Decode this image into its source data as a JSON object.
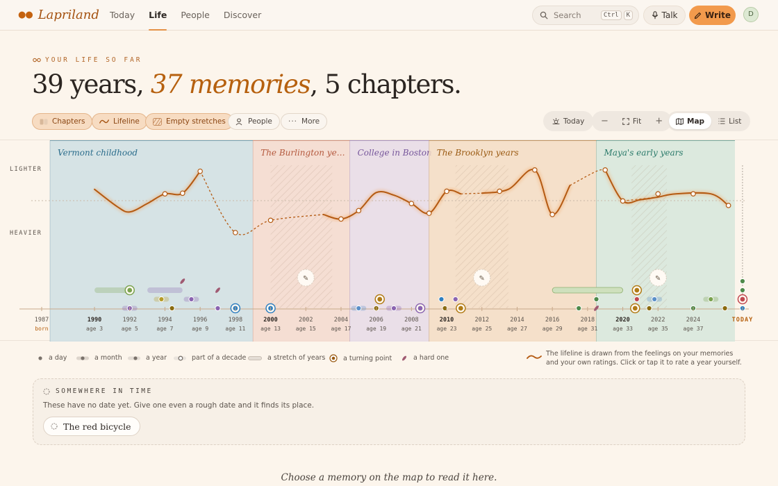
{
  "app": {
    "name": "Lapriland",
    "avatar_initial": "D"
  },
  "nav": [
    {
      "label": "Today",
      "active": false
    },
    {
      "label": "Life",
      "active": true
    },
    {
      "label": "People",
      "active": false
    },
    {
      "label": "Discover",
      "active": false
    }
  ],
  "search": {
    "placeholder": "Search",
    "shortcut_mod": "Ctrl",
    "shortcut_key": "K"
  },
  "actions": {
    "talk": "Talk",
    "write": "Write"
  },
  "hero": {
    "kicker": "YOUR LIFE SO FAR",
    "headline_years": "39 years,",
    "headline_memories": "37 memories",
    "headline_chapters": ", 5 chapters."
  },
  "chips": [
    {
      "label": "Chapters",
      "on": true
    },
    {
      "label": "Lifeline",
      "on": true
    },
    {
      "label": "Empty stretches",
      "on": true
    },
    {
      "label": "People",
      "on": false
    },
    {
      "label": "More",
      "on": false
    }
  ],
  "view": {
    "today": "Today",
    "fit": "Fit",
    "map": "Map",
    "list": "List"
  },
  "chart_data": {
    "type": "line",
    "title": "",
    "xlabel": "",
    "ylabel": "",
    "y_labels": {
      "top": "LIGHTER",
      "bottom": "HEAVIER"
    },
    "x_range": [
      1987,
      2026
    ],
    "chapters": [
      {
        "name": "Vermont childhood",
        "start": 1987,
        "end": 1999,
        "color": "#cfdfe4",
        "text": "#2b6d8c"
      },
      {
        "name": "The Burlington ye…",
        "start": 1999,
        "end": 2004.5,
        "color": "#f3d9cf",
        "text": "#b4593e"
      },
      {
        "name": "College in Boston",
        "start": 2004.5,
        "end": 2009,
        "color": "#e6dbe8",
        "text": "#76569b"
      },
      {
        "name": "The Brooklyn years",
        "start": 2009,
        "end": 2018.5,
        "color": "#f3dcc4",
        "text": "#9a5a12"
      },
      {
        "name": "Maya's early years",
        "start": 2018.5,
        "end": 2026.5,
        "color": "#d6e6dc",
        "text": "#2a7a6a"
      }
    ],
    "empty_stretches": [
      [
        2000,
        2003.5
      ],
      [
        2010.5,
        2013.5
      ],
      [
        2020.5,
        2022.5
      ]
    ],
    "lifeline_solid": [
      [
        [
          1990,
          0.33
        ],
        [
          1991.3,
          0.6
        ],
        [
          1992,
          0.68
        ],
        [
          1993,
          0.55
        ],
        [
          1994,
          0.4
        ],
        [
          1995,
          0.39
        ],
        [
          1996,
          0.05
        ]
      ],
      [
        [
          2003,
          0.72
        ],
        [
          2004,
          0.79
        ],
        [
          2005,
          0.66
        ],
        [
          2006,
          0.38
        ],
        [
          2007,
          0.42
        ],
        [
          2008,
          0.55
        ],
        [
          2009,
          0.7
        ],
        [
          2010,
          0.36
        ],
        [
          2010.8,
          0.4
        ]
      ],
      [
        [
          2012,
          0.39
        ],
        [
          2013.5,
          0.33
        ],
        [
          2015,
          0.03
        ],
        [
          2016,
          0.72
        ],
        [
          2017,
          0.27
        ]
      ],
      [
        [
          2019,
          0.03
        ],
        [
          2020,
          0.51
        ],
        [
          2021,
          0.49
        ],
        [
          2022,
          0.45
        ],
        [
          2023,
          0.4
        ],
        [
          2025,
          0.4
        ],
        [
          2026,
          0.58
        ]
      ]
    ],
    "lifeline_dashed": [
      [
        [
          1996,
          0.05
        ],
        [
          1998,
          1.0
        ],
        [
          2000,
          0.81
        ],
        [
          2003,
          0.72
        ]
      ],
      [
        [
          2010.8,
          0.4
        ],
        [
          2012,
          0.39
        ]
      ],
      [
        [
          2017,
          0.27
        ],
        [
          2018.5,
          0.05
        ],
        [
          2019,
          0.03
        ]
      ],
      [
        [
          2020,
          0.51
        ],
        [
          2022,
          0.45
        ]
      ]
    ],
    "rated_points": [
      [
        1994,
        0.4
      ],
      [
        1995,
        0.39
      ],
      [
        1996,
        0.05
      ],
      [
        1998,
        1.0
      ],
      [
        2000,
        0.81
      ],
      [
        2004,
        0.79
      ],
      [
        2005,
        0.66
      ],
      [
        2008,
        0.55
      ],
      [
        2009,
        0.7
      ],
      [
        2010,
        0.36
      ],
      [
        2013,
        0.36
      ],
      [
        2015,
        0.03
      ],
      [
        2016,
        0.72
      ],
      [
        2019,
        0.03
      ],
      [
        2020,
        0.51
      ],
      [
        2022,
        0.4
      ],
      [
        2024,
        0.4
      ],
      [
        2026,
        0.58
      ]
    ],
    "memories": [
      {
        "kind": "decade",
        "start": 1990,
        "end": 1992,
        "row": 2,
        "color": "#7aa24f"
      },
      {
        "kind": "turning",
        "x": 1992,
        "row": 2,
        "color": "#7aa24f"
      },
      {
        "kind": "hard",
        "x": 1995,
        "row": 1,
        "color": "#a05a72"
      },
      {
        "kind": "decade",
        "start": 1993,
        "end": 1995,
        "row": 2,
        "color": "#8a64b0"
      },
      {
        "kind": "hard",
        "x": 1997,
        "row": 2,
        "color": "#a05a72"
      },
      {
        "kind": "year",
        "x": 1993.8,
        "row": 3,
        "color": "#b59b28"
      },
      {
        "kind": "year",
        "x": 1995.5,
        "row": 3,
        "color": "#8a64b0"
      },
      {
        "kind": "month",
        "x": 1992,
        "row": 4,
        "color": "#8a64b0"
      },
      {
        "kind": "day",
        "x": 1994.4,
        "row": 4,
        "color": "#8a6b10"
      },
      {
        "kind": "day",
        "x": 1997,
        "row": 4,
        "color": "#8a64b0"
      },
      {
        "kind": "turning",
        "x": 1998,
        "row": 4,
        "color": "#2f7fc0"
      },
      {
        "kind": "turning",
        "x": 2000,
        "row": 4,
        "color": "#2f7fc0"
      },
      {
        "kind": "turning",
        "x": 2006.2,
        "row": 3,
        "color": "#b07a14"
      },
      {
        "kind": "month",
        "x": 2005,
        "row": 4,
        "color": "#5a8fc8"
      },
      {
        "kind": "day",
        "x": 2006,
        "row": 4,
        "color": "#8a6b10"
      },
      {
        "kind": "month",
        "x": 2007,
        "row": 4,
        "color": "#8a64b0"
      },
      {
        "kind": "turning",
        "x": 2008.5,
        "row": 4,
        "color": "#8a64b0"
      },
      {
        "kind": "day",
        "x": 2009.7,
        "row": 3,
        "color": "#2f7fc0"
      },
      {
        "kind": "day",
        "x": 2009.9,
        "row": 4,
        "color": "#8a6b10"
      },
      {
        "kind": "day",
        "x": 2010.5,
        "row": 3,
        "color": "#8a64b0"
      },
      {
        "kind": "turning",
        "x": 2010.8,
        "row": 4,
        "color": "#b07a14"
      },
      {
        "kind": "stretch",
        "start": 2016,
        "end": 2020,
        "row": 2,
        "color": "#7aa24f"
      },
      {
        "kind": "day",
        "x": 2018.5,
        "row": 3,
        "color": "#4f8a4a"
      },
      {
        "kind": "day",
        "x": 2017.5,
        "row": 4,
        "color": "#4f8a4a"
      },
      {
        "kind": "hard",
        "x": 2018.5,
        "row": 4,
        "color": "#a05a72"
      },
      {
        "kind": "turning",
        "x": 2020.8,
        "row": 2,
        "color": "#b07a14"
      },
      {
        "kind": "day",
        "x": 2020.8,
        "row": 3,
        "color": "#c0474f"
      },
      {
        "kind": "turning",
        "x": 2020.7,
        "row": 4,
        "color": "#b07a14"
      },
      {
        "kind": "month",
        "x": 2021.8,
        "row": 3,
        "color": "#5a8fc8"
      },
      {
        "kind": "day",
        "x": 2021.5,
        "row": 4,
        "color": "#8a6b10"
      },
      {
        "kind": "month",
        "x": 2025,
        "row": 3,
        "color": "#7aa24f"
      },
      {
        "kind": "day",
        "x": 2024,
        "row": 4,
        "color": "#4f8a4a"
      },
      {
        "kind": "day",
        "x": 2025.8,
        "row": 4,
        "color": "#8a6b10"
      },
      {
        "kind": "day",
        "x": 2026.8,
        "row": 1,
        "color": "#4f8a4a"
      },
      {
        "kind": "day",
        "x": 2026.8,
        "row": 2,
        "color": "#4f8a4a"
      },
      {
        "kind": "turning",
        "x": 2026.8,
        "row": 3,
        "color": "#c0474f"
      },
      {
        "kind": "day",
        "x": 2026.8,
        "row": 4,
        "color": "#2f7fc0"
      }
    ],
    "write_markers": [
      2002,
      2012,
      2022
    ],
    "x_ticks": [
      {
        "year": "1987",
        "age": "born",
        "x": 1987,
        "bold": false
      },
      {
        "year": "1990",
        "age": "age 3",
        "x": 1990,
        "bold": true
      },
      {
        "year": "1992",
        "age": "age 5",
        "x": 1992,
        "bold": false
      },
      {
        "year": "1994",
        "age": "age 7",
        "x": 1994,
        "bold": false
      },
      {
        "year": "1996",
        "age": "age 9",
        "x": 1996,
        "bold": false
      },
      {
        "year": "1998",
        "age": "age 11",
        "x": 1998,
        "bold": false
      },
      {
        "year": "2000",
        "age": "age 13",
        "x": 2000,
        "bold": true
      },
      {
        "year": "2002",
        "age": "age 15",
        "x": 2002,
        "bold": false
      },
      {
        "year": "2004",
        "age": "age 17",
        "x": 2004,
        "bold": false
      },
      {
        "year": "2006",
        "age": "age 19",
        "x": 2006,
        "bold": false
      },
      {
        "year": "2008",
        "age": "age 21",
        "x": 2008,
        "bold": false
      },
      {
        "year": "2010",
        "age": "age 23",
        "x": 2010,
        "bold": true
      },
      {
        "year": "2012",
        "age": "age 25",
        "x": 2012,
        "bold": false
      },
      {
        "year": "2014",
        "age": "age 27",
        "x": 2014,
        "bold": false
      },
      {
        "year": "2016",
        "age": "age 29",
        "x": 2016,
        "bold": false
      },
      {
        "year": "2018",
        "age": "age 31",
        "x": 2018,
        "bold": false
      },
      {
        "year": "2020",
        "age": "age 33",
        "x": 2020,
        "bold": true
      },
      {
        "year": "2022",
        "age": "age 35",
        "x": 2022,
        "bold": false
      },
      {
        "year": "2024",
        "age": "age 37",
        "x": 2024,
        "bold": false
      },
      {
        "year": "TODAY",
        "age": "",
        "x": 2026.8,
        "bold": true
      }
    ]
  },
  "legend": {
    "items": [
      "a day",
      "a month",
      "a year",
      "part of a decade",
      "a stretch of years",
      "a turning point",
      "a hard one"
    ],
    "note": "The lifeline is drawn from the feelings on your memories and your own ratings. Click or tap it to rate a year yourself."
  },
  "somewhere": {
    "title": "SOMEWHERE IN TIME",
    "desc": "These have no date yet. Give one even a rough date and it finds its place.",
    "items": [
      "The red bicycle"
    ]
  },
  "footer": "Choose a memory on the map to read it here.",
  "colors": {
    "accent": "#f29a4c",
    "brand": "#b6600e",
    "lifeline": "#b45a12"
  }
}
